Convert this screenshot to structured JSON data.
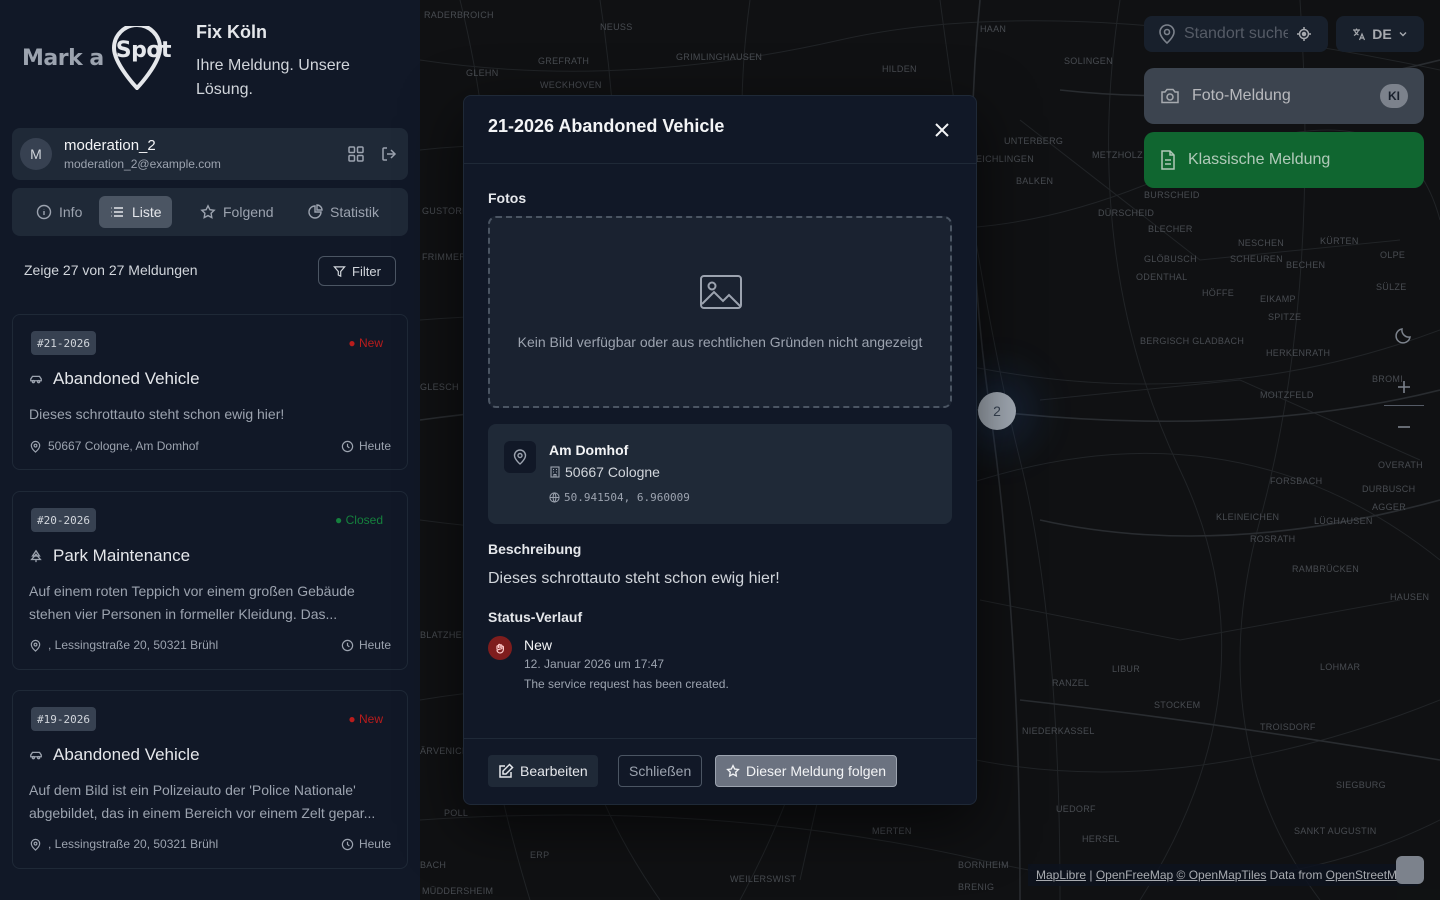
{
  "brand": {
    "logo_text_left": "Mark a",
    "logo_text_right": "Spot",
    "app_title": "Fix Köln",
    "tagline": "Ihre Meldung. Unsere Lösung."
  },
  "user": {
    "initial": "M",
    "name": "moderation_2",
    "email": "moderation_2@example.com"
  },
  "tabs": [
    {
      "label": "Info",
      "icon": "info-icon",
      "active": false
    },
    {
      "label": "Liste",
      "icon": "list-icon",
      "active": true
    },
    {
      "label": "Folgend",
      "icon": "star-icon",
      "active": false
    },
    {
      "label": "Statistik",
      "icon": "chart-pie-icon",
      "active": false
    }
  ],
  "list": {
    "count_text": "Zeige 27 von 27 Meldungen",
    "filter_label": "Filter",
    "items": [
      {
        "id": "#21-2026",
        "status": "New",
        "title": "Abandoned Vehicle",
        "icon": "car-icon",
        "desc": "Dieses schrottauto steht schon ewig hier!",
        "location": "50667 Cologne, Am Domhof",
        "time": "Heute"
      },
      {
        "id": "#20-2026",
        "status": "Closed",
        "title": "Park Maintenance",
        "icon": "tree-icon",
        "desc": "Auf einem roten Teppich vor einem großen Gebäude stehen vier Personen in formeller Kleidung. Das...",
        "location": ", Lessingstraße 20, 50321 Brühl",
        "time": "Heute"
      },
      {
        "id": "#19-2026",
        "status": "New",
        "title": "Abandoned Vehicle",
        "icon": "car-icon",
        "desc": "Auf dem Bild ist ein Polizeiauto der 'Police Nationale' abgebildet, das in einem Bereich vor einem Zelt gepar...",
        "location": ", Lessingstraße 20, 50321 Brühl",
        "time": "Heute"
      }
    ]
  },
  "map": {
    "search_placeholder": "Standort suchen",
    "language": "DE",
    "foto_label": "Foto-Meldung",
    "ki_badge": "KI",
    "classic_label": "Klassische Meldung",
    "cluster_count": "2",
    "attribution": {
      "maplibre": "MapLibre",
      "sep1": " | ",
      "openfreemap": "OpenFreeMap",
      "sep2": " ",
      "openmaptiles": "© OpenMapTiles",
      "data_from": " Data from ",
      "osm": "OpenStreetMap"
    },
    "places": [
      "RADERBROICH",
      "NEUSS",
      "GREFRATH",
      "GRIMLINGHAUSEN",
      "GLEHN",
      "WECKHOVEN",
      "HILDEN",
      "HAAN",
      "SOLINGEN",
      "UNTERBERG",
      "EICHLINGEN",
      "METZHOLZ",
      "BALKEN",
      "BURSCHEID",
      "DÜRSCHEID",
      "BLECHER",
      "NESCHEN",
      "KÜRTEN",
      "SCHEUREN",
      "BECHEN",
      "GLÖBUSCH",
      "ODENTHAL",
      "HÖFFE",
      "OLPE",
      "SÜLZE",
      "EIKAMP",
      "SPITZE",
      "BERGISCH GLADBACH",
      "HERKENRATH",
      "BROMI",
      "MOITZFELD",
      "FORSBACH",
      "DURBUSCH",
      "AGGER",
      "KLEINEICHEN",
      "LÜGHAUSEN",
      "ROSRATH",
      "RAMBRÜCKEN",
      "HAUSEN",
      "OVERATH",
      "LOHMAR",
      "RANZEL",
      "LIBUR",
      "STOCKEM",
      "NIEDERKASSEL",
      "TROISDORF",
      "SIEGBURG",
      "UEDORF",
      "SANKT AUGUSTIN",
      "HERSEL",
      "MERTEN",
      "BORNHEIM",
      "BRENIG",
      "WEILERSWIST",
      "ERP",
      "POLL",
      "BLATZHEIM",
      "ÄRVENICH",
      "FRIMMER",
      "GUSTORF",
      "BACH",
      "MÜDDERSHEIM",
      "GLESCH"
    ]
  },
  "modal": {
    "title": "21-2026 Abandoned Vehicle",
    "photos_label": "Fotos",
    "no_image": "Kein Bild verfügbar oder aus rechtlichen Gründen nicht angezeigt",
    "location": {
      "street": "Am Domhof",
      "city": "50667 Cologne",
      "coords": "50.941504, 6.960009"
    },
    "description_label": "Beschreibung",
    "description": "Dieses schrottauto steht schon ewig hier!",
    "history_label": "Status-Verlauf",
    "history": {
      "status": "New",
      "date": "12. Januar 2026 um 17:47",
      "note": "The service request has been created."
    },
    "buttons": {
      "edit": "Bearbeiten",
      "close": "Schließen",
      "follow": "Dieser Meldung folgen"
    }
  },
  "colors": {
    "accent_green": "#15803d",
    "status_new": "#b91c1c",
    "status_closed": "#15803d",
    "sidebar_bg": "#111827",
    "map_bg": "#141618"
  }
}
